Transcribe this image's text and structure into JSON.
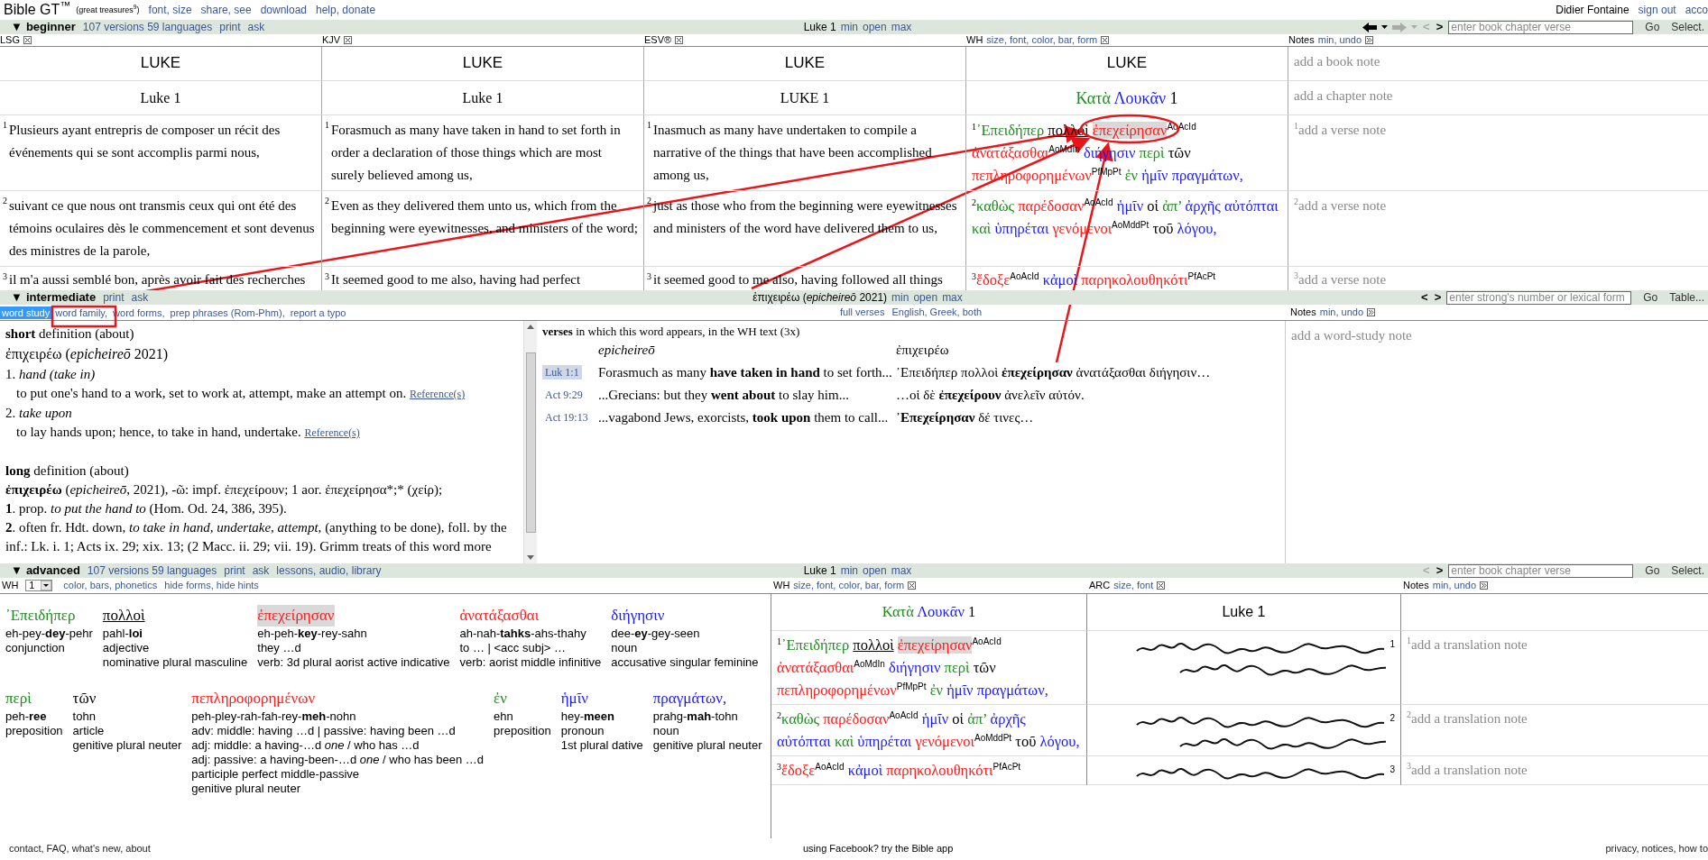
{
  "top": {
    "logo": "Bible GT$^{™}$",
    "tagline": "(great treasures$^{9}$)",
    "links": [
      "font, size",
      "share, see",
      "download",
      "help, donate"
    ],
    "user": "Didier Fontaine",
    "user_links": [
      "sign out",
      "acco"
    ]
  },
  "beginner": {
    "toggle": "▼",
    "title": "beginner",
    "links": [
      "107 versions 59 languages",
      "print",
      "ask"
    ],
    "reference": "Luke 1",
    "view_links": [
      "min",
      "open",
      "max"
    ],
    "history": {
      "back": {
        "disabled": false
      },
      "forward": {
        "disabled": true
      }
    },
    "nav": {
      "prev": {
        "text": "<",
        "disabled": true
      },
      "next": {
        "text": ">",
        "disabled": false
      }
    },
    "search": {
      "placeholder": "enter book chapter verse"
    },
    "go": "Go",
    "select": "Select.",
    "columns": [
      {
        "name": "LSG"
      },
      {
        "name": "KJV"
      },
      {
        "name": "ESV®"
      },
      {
        "name": "WH",
        "options": "size, font, color, bar, form"
      }
    ],
    "notes": {
      "name": "Notes",
      "options": "min, undo"
    },
    "book_row": {
      "texts": [
        "LUKE",
        "LUKE",
        "LUKE",
        "LUKE"
      ],
      "note": "add a book note"
    },
    "chapter_row": {
      "texts": [
        "Luke 1",
        "Luke 1",
        "LUKE 1"
      ],
      "wh": [
        {
          "text": "Κατὰ",
          "color": "#1e8c1e"
        },
        {
          "text": "Λουκᾶν",
          "color": "#1a1aff"
        },
        {
          "text": "1",
          "color": "#000000"
        }
      ],
      "note": "add a chapter note"
    },
    "verses": [
      {
        "cells": [
          {
            "number": "1",
            "text": "Plusieurs ayant entrepris de composer un récit des événements qui se sont accomplis parmi nous,"
          },
          {
            "number": "1",
            "text": "Forasmuch as many have taken in hand to set forth in order a declaration of those things which are most surely believed among us,"
          },
          {
            "number": "1",
            "text": "Inasmuch as many have undertaken to compile a narrative of the things that have been accomplished among us,"
          }
        ],
        "wh": {
          "number": "1",
          "words": [
            {
              "text": "᾿Επειδήπερ",
              "color": "#1e8c1e",
              "highlighted": false,
              "underlined": false
            },
            {
              "text": "πολλοὶ",
              "color": "#000000",
              "highlighted": false,
              "underlined": true
            },
            {
              "text": "ἐπεχείρησαν",
              "color": "#ff1a1a",
              "highlighted": true,
              "underlined": false,
              "tag": "AoAcId"
            },
            {
              "text": "ἀνατάξασθαι",
              "color": "#ff1a1a",
              "highlighted": false,
              "underlined": false,
              "tag": "AoMdIn"
            },
            {
              "text": "διήγησιν",
              "color": "#1a1aff",
              "highlighted": false,
              "underlined": false
            },
            {
              "text": "περὶ",
              "color": "#1e8c1e",
              "highlighted": false,
              "underlined": false
            },
            {
              "text": "τῶν",
              "color": "#000000",
              "highlighted": false,
              "underlined": false
            },
            {
              "text": "πεπληροφορημένων",
              "color": "#ff1a1a",
              "highlighted": false,
              "underlined": false,
              "tag": "PfMpPt"
            },
            {
              "text": "ἐν",
              "color": "#1e8c1e",
              "highlighted": false,
              "underlined": false
            },
            {
              "text": "ἡμῖν",
              "color": "#1a1aff",
              "highlighted": false,
              "underlined": false
            },
            {
              "text": "πραγμάτων,",
              "color": "#1a1aff",
              "highlighted": false,
              "underlined": false
            }
          ]
        },
        "note": {
          "number": "1",
          "text": "add a verse note"
        }
      },
      {
        "cells": [
          {
            "number": "2",
            "text": "suivant ce que nous ont transmis ceux qui ont été des témoins oculaires dès le commencement et sont devenus des ministres de la parole,"
          },
          {
            "number": "2",
            "text": "Even as they delivered them unto us, which from the beginning were eyewitnesses, and ministers of the word;"
          },
          {
            "number": "2",
            "text": "just as those who from the beginning were eyewitnesses and ministers of the word have delivered them to us,"
          }
        ],
        "wh": {
          "number": "2",
          "words": [
            {
              "text": "καθὼς",
              "color": "#1e8c1e",
              "highlighted": false,
              "underlined": false
            },
            {
              "text": "παρέδοσαν",
              "color": "#ff1a1a",
              "highlighted": false,
              "underlined": false,
              "tag": "AoAcId"
            },
            {
              "text": "ἡμῖν",
              "color": "#1a1aff",
              "highlighted": false,
              "underlined": false
            },
            {
              "text": "οἱ",
              "color": "#000000",
              "highlighted": false,
              "underlined": false
            },
            {
              "text": "ἀπ’",
              "color": "#1e8c1e",
              "highlighted": false,
              "underlined": false
            },
            {
              "text": "ἀρχῆς",
              "color": "#1a1aff",
              "highlighted": false,
              "underlined": false
            },
            {
              "text": "αὐτόπται",
              "color": "#1a1aff",
              "highlighted": false,
              "underlined": false
            },
            {
              "text": "καὶ",
              "color": "#1e8c1e",
              "highlighted": false,
              "underlined": false
            },
            {
              "text": "ὑπηρέται",
              "color": "#1a1aff",
              "highlighted": false,
              "underlined": false
            },
            {
              "text": "γενόμενοι",
              "color": "#ff1a1a",
              "highlighted": false,
              "underlined": false,
              "tag": "AoMddPt"
            },
            {
              "text": "τοῦ",
              "color": "#000000",
              "highlighted": false,
              "underlined": false
            },
            {
              "text": "λόγου,",
              "color": "#1a1aff",
              "highlighted": false,
              "underlined": false
            }
          ]
        },
        "note": {
          "number": "2",
          "text": "add a verse note"
        }
      },
      {
        "cells": [
          {
            "number": "3",
            "text": "il m'a aussi semblé bon, après avoir fait des recherches"
          },
          {
            "number": "3",
            "text": "It seemed good to me also, having had perfect"
          },
          {
            "number": "3",
            "text": "it seemed good to me also, having followed all things"
          }
        ],
        "wh": {
          "number": "3",
          "words": [
            {
              "text": "ἔδοξε",
              "color": "#ff1a1a",
              "highlighted": false,
              "underlined": false,
              "tag": "AoAcId"
            },
            {
              "text": "κἀμοὶ",
              "color": "#1a1aff",
              "highlighted": false,
              "underlined": false
            },
            {
              "text": "παρηκολουθηκότι",
              "color": "#ff1a1a",
              "highlighted": false,
              "underlined": false,
              "tag": "PfAcPt"
            }
          ]
        },
        "note": {
          "number": "3",
          "text": "add a verse note"
        }
      }
    ]
  },
  "intermediate": {
    "toggle": "▼",
    "title": "intermediate",
    "links": [
      "print",
      "ask"
    ],
    "word": "ἐπιχειρέω (*epicheireō* 2021)",
    "view_links": [
      "min",
      "open",
      "max"
    ],
    "nav": {
      "prev": {
        "text": "<",
        "disabled": false
      },
      "next": {
        "text": ">",
        "disabled": false
      }
    },
    "search": {
      "placeholder": "enter strong's number or lexical form"
    },
    "go": "Go",
    "select": "Table...",
    "tabs": [
      {
        "label": "word study",
        "selected": true
      },
      {
        "label": "word family,",
        "selected": false
      },
      {
        "label": "word forms,",
        "selected": false
      },
      {
        "label": "prep phrases (Rom-Phm),",
        "selected": false
      },
      {
        "label": "report a typo",
        "selected": false
      }
    ],
    "verse_options": [
      "full verses",
      "English, Greek, both"
    ],
    "notes": {
      "name": "Notes",
      "options": "min, undo",
      "prompt": "add a word-study note"
    },
    "definition": [
      {
        "kind": "heading",
        "text": "**short** definition (about)"
      },
      {
        "kind": "lemma",
        "text": "ἐπιχειρέω (*epicheireō* 2021)"
      },
      {
        "kind": "sense",
        "text": "1. *hand (take in)*"
      },
      {
        "kind": "gloss",
        "text": "to put one's hand to a work, set to work at, attempt, make an attempt on.",
        "link": "Reference(s)"
      },
      {
        "kind": "sense",
        "text": "2. *take upon*"
      },
      {
        "kind": "gloss",
        "text": "to lay hands upon; hence, to take in hand, undertake.",
        "link": "Reference(s)"
      },
      {
        "kind": "gap"
      },
      {
        "kind": "heading",
        "text": "**long** definition (about)"
      },
      {
        "kind": "paragraph",
        "text": "**ἐπιχειρέω** (*epicheireō*, 2021), -ῶ: impf. ἐπεχείρουν; 1 aor. ἐπεχείρησα*;* (χείρ);"
      },
      {
        "kind": "paragraph",
        "text": "**1**. prop. *to put the hand to* (Hom. Od. 24, 386, 395)."
      },
      {
        "kind": "paragraph",
        "text": "**2**. often fr. Hdt. down, *to take in hand, undertake, attempt,* (anything to be done), foll. by the inf.: Lk. i. 1; Acts ix. 29; xix. 13; (2 Macc. ii. 29; vii. 19). Grimm treats of this word more"
      }
    ],
    "verses": {
      "heading": "**verses** in which this word appears, in the WH text (3x)",
      "english_header": "epicheireō",
      "greek_header": "ἐπιχειρέω",
      "rows": [
        {
          "ref": "Luk 1:1",
          "selected": true,
          "english": "Forasmuch as many **have taken in hand** to set forth...",
          "greek": "᾿Επειδήπερ πολλοὶ **ἐπεχείρησαν** ἀνατάξασθαι διήγησιν…"
        },
        {
          "ref": "Act 9:29",
          "selected": false,
          "english": "...Grecians: but they **went about** to slay him...",
          "greek": "…οἱ δὲ **ἐπεχείρουν** ἀνελεῖν αὐτόν."
        },
        {
          "ref": "Act 19:13",
          "selected": false,
          "english": "...vagabond Jews, exorcists, **took upon** them to call...",
          "greek": "**᾿Επεχείρησαν** δέ τινες…"
        }
      ]
    }
  },
  "advanced": {
    "toggle": "▼",
    "title": "advanced",
    "links": [
      "107 versions 59 languages",
      "print",
      "ask",
      "lessons, audio, library"
    ],
    "reference": "Luke 1",
    "view_links": [
      "min",
      "open",
      "max"
    ],
    "nav": {
      "prev": {
        "text": "<",
        "disabled": true
      },
      "next": {
        "text": ">",
        "disabled": false
      }
    },
    "search": {
      "placeholder": "enter book chapter verse"
    },
    "go": "Go",
    "select": "Select.",
    "version": {
      "label": "WH",
      "value": "1"
    },
    "options": [
      "color, bars, phonetics",
      "hide forms, hide hints"
    ],
    "interlinear": [
      [
        {
          "text": "᾿Επειδήπερ",
          "color": "#1e8c1e",
          "highlighted": false,
          "underlined": false,
          "phonetic": "eh-pey-**dey**-pehr",
          "lines": [
            "conjunction"
          ]
        },
        {
          "text": "πολλοὶ",
          "color": "#000000",
          "highlighted": false,
          "underlined": true,
          "phonetic": "pahl-**loi**",
          "lines": [
            "adjective",
            "nominative plural masculine"
          ]
        },
        {
          "text": "ἐπεχείρησαν",
          "color": "#ff1a1a",
          "highlighted": true,
          "underlined": false,
          "phonetic": "eh-peh-**key**-rey-sahn",
          "lines": [
            "they …d",
            "verb: 3d plural aorist active indicative"
          ]
        },
        {
          "text": "ἀνατάξασθαι",
          "color": "#ff1a1a",
          "highlighted": false,
          "underlined": false,
          "phonetic": "ah-nah-**tahks**-ahs-thahy",
          "lines": [
            "to … | <acc subj> …",
            "verb: aorist middle infinitive"
          ]
        },
        {
          "text": "διήγησιν",
          "color": "#1a1aff",
          "highlighted": false,
          "underlined": false,
          "phonetic": "dee-**ey**-gey-seen",
          "lines": [
            "noun",
            "accusative singular feminine"
          ]
        }
      ],
      [
        {
          "text": "περὶ",
          "color": "#1e8c1e",
          "highlighted": false,
          "underlined": false,
          "phonetic": "peh-**ree**",
          "lines": [
            "preposition"
          ]
        },
        {
          "text": "τῶν",
          "color": "#000000",
          "highlighted": false,
          "underlined": false,
          "phonetic": "tohn",
          "lines": [
            "article",
            "genitive plural neuter"
          ]
        },
        {
          "text": "πεπληροφορημένων",
          "color": "#ff1a1a",
          "highlighted": false,
          "underlined": false,
          "phonetic": "peh-pley-rah-fah-rey-**meh**-nohn",
          "lines": [
            "adv: middle: having …d | passive: having been …d",
            "adj:  middle: a having-…d *one* / who has …d",
            "adj:  passive: a having-been-…d *one* / who has been …d",
            "participle perfect middle-passive",
            "genitive plural neuter"
          ]
        },
        {
          "text": "ἐν",
          "color": "#1e8c1e",
          "highlighted": false,
          "underlined": false,
          "phonetic": "ehn",
          "lines": [
            "preposition"
          ]
        },
        {
          "text": "ἡμῖν",
          "color": "#1a1aff",
          "highlighted": false,
          "underlined": false,
          "phonetic": "hey-**meen**",
          "lines": [
            "pronoun",
            "1st plural dative"
          ]
        },
        {
          "text": "πραγμάτων,",
          "color": "#1a1aff",
          "highlighted": false,
          "underlined": false,
          "phonetic": "prahg-**mah**-tohn",
          "lines": [
            "noun",
            "genitive plural neuter"
          ]
        }
      ]
    ],
    "columns": [
      {
        "name": "WH",
        "options": "size, font, color, bar, form"
      },
      {
        "name": "ARC",
        "options": "size, font"
      }
    ],
    "notes": {
      "name": "Notes",
      "options": "min, undo"
    },
    "title_row": {
      "wh": [
        {
          "text": "Κατὰ",
          "color": "#1e8c1e"
        },
        {
          "text": "Λουκᾶν",
          "color": "#1a1aff"
        },
        {
          "text": "1",
          "color": "#000000"
        }
      ],
      "arc": "Luke 1"
    },
    "verses": [
      {
        "wh": {
          "number": "1",
          "words": [
            {
              "text": "᾿Επειδήπερ",
              "color": "#1e8c1e",
              "highlighted": false,
              "underlined": false
            },
            {
              "text": "πολλοὶ",
              "color": "#000000",
              "highlighted": false,
              "underlined": true
            },
            {
              "text": "ἐπεχείρησαν",
              "color": "#ff1a1a",
              "highlighted": true,
              "underlined": false,
              "tag": "AoAcId"
            },
            {
              "text": "ἀνατάξασθαι",
              "color": "#ff1a1a",
              "highlighted": false,
              "underlined": false,
              "tag": "AoMdIn"
            },
            {
              "text": "διήγησιν",
              "color": "#1a1aff",
              "highlighted": false,
              "underlined": false
            },
            {
              "text": "περὶ",
              "color": "#1e8c1e",
              "highlighted": false,
              "underlined": false
            },
            {
              "text": "τῶν",
              "color": "#000000",
              "highlighted": false,
              "underlined": false
            },
            {
              "text": "πεπληροφορημένων",
              "color": "#ff1a1a",
              "highlighted": false,
              "underlined": false,
              "tag": "PfMpPt"
            },
            {
              "text": "ἐν",
              "color": "#1e8c1e",
              "highlighted": false,
              "underlined": false
            },
            {
              "text": "ἡμῖν",
              "color": "#1a1aff",
              "highlighted": false,
              "underlined": false
            },
            {
              "text": "πραγμάτων,",
              "color": "#1a1aff",
              "highlighted": false,
              "underlined": false
            }
          ]
        },
        "arc": {
          "number": "1"
        },
        "note": {
          "number": "1",
          "text": "add a translation note"
        }
      },
      {
        "wh": {
          "number": "2",
          "words": [
            {
              "text": "καθὼς",
              "color": "#1e8c1e",
              "highlighted": false,
              "underlined": false
            },
            {
              "text": "παρέδοσαν",
              "color": "#ff1a1a",
              "highlighted": false,
              "underlined": false,
              "tag": "AoAcId"
            },
            {
              "text": "ἡμῖν",
              "color": "#1a1aff",
              "highlighted": false,
              "underlined": false
            },
            {
              "text": "οἱ",
              "color": "#000000",
              "highlighted": false,
              "underlined": false
            },
            {
              "text": "ἀπ’",
              "color": "#1e8c1e",
              "highlighted": false,
              "underlined": false
            },
            {
              "text": "ἀρχῆς",
              "color": "#1a1aff",
              "highlighted": false,
              "underlined": false
            },
            {
              "text": "αὐτόπται",
              "color": "#1a1aff",
              "highlighted": false,
              "underlined": false
            },
            {
              "text": "καὶ",
              "color": "#1e8c1e",
              "highlighted": false,
              "underlined": false
            },
            {
              "text": "ὑπηρέται",
              "color": "#1a1aff",
              "highlighted": false,
              "underlined": false
            },
            {
              "text": "γενόμενοι",
              "color": "#ff1a1a",
              "highlighted": false,
              "underlined": false,
              "tag": "AoMddPt"
            },
            {
              "text": "τοῦ",
              "color": "#000000",
              "highlighted": false,
              "underlined": false
            },
            {
              "text": "λόγου,",
              "color": "#1a1aff",
              "highlighted": false,
              "underlined": false
            }
          ]
        },
        "arc": {
          "number": "2"
        },
        "note": {
          "number": "2",
          "text": "add a translation note"
        }
      },
      {
        "wh": {
          "number": "3",
          "words": [
            {
              "text": "ἔδοξε",
              "color": "#ff1a1a",
              "highlighted": false,
              "underlined": false,
              "tag": "AoAcId"
            },
            {
              "text": "κἀμοὶ",
              "color": "#1a1aff",
              "highlighted": false,
              "underlined": false
            },
            {
              "text": "παρηκολουθηκότι",
              "color": "#ff1a1a",
              "highlighted": false,
              "underlined": false,
              "tag": "PfAcPt"
            }
          ]
        },
        "arc": {
          "number": "3"
        },
        "note": {
          "number": "3",
          "text": "add a translation note"
        }
      }
    ]
  },
  "footer": {
    "left": "contact, FAQ, what's new, about",
    "center": "using Facebook? try the Bible app",
    "right": "privacy, notices, how to"
  }
}
